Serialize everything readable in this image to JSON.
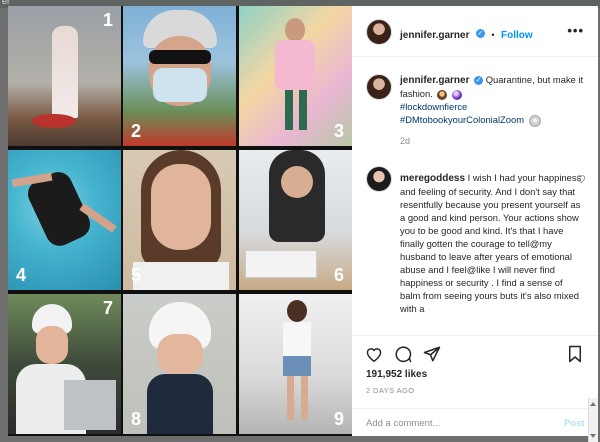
{
  "window": {
    "title_fragment": "er"
  },
  "post_photo": {
    "alt": "",
    "tiles": [
      {
        "number": "1"
      },
      {
        "number": "2"
      },
      {
        "number": "3"
      },
      {
        "number": "4"
      },
      {
        "number": "5"
      },
      {
        "number": "6"
      },
      {
        "number": "7"
      },
      {
        "number": "8"
      },
      {
        "number": "9"
      }
    ]
  },
  "header": {
    "username": "jennifer.garner",
    "verified_glyph": "✓",
    "dot": "•",
    "follow_label": "Follow",
    "more_glyph": "•••"
  },
  "caption": {
    "username": "jennifer.garner",
    "text": " Quarantine, but make it fashion. ",
    "tag1": "#lockdownfierce",
    "tag2": "#DMtobookyourColonialZoom",
    "age": "2d"
  },
  "comment": {
    "username": "meregoddess",
    "text": " I wish I had your happiness and feeling of security. And I don't say that resentfully because you present yourself as a good and kind person. Your actions show you to be good and kind. It's that I have finally gotten the courage to tell@my husband to leave after years of emotional abuse and I feel@like I will never find happiness or security . I find a sense of balm from seeing yours buts it's also mixed with a"
  },
  "actions": {
    "likes": "191,952 likes",
    "date": "2 DAYS AGO"
  },
  "add_comment": {
    "placeholder": "Add a comment...",
    "post_label": "Post"
  },
  "colors": {
    "link": "#0095f6",
    "hashtag": "#00376b",
    "muted": "#8e8e8e"
  }
}
